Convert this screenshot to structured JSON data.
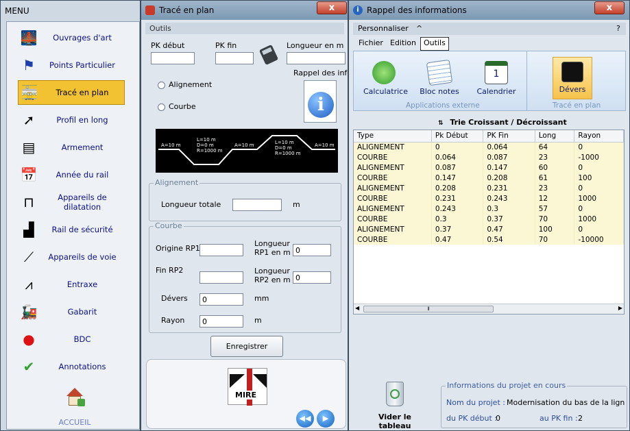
{
  "menu": {
    "title": "MENU",
    "items": [
      {
        "label": "Ouvrages d'art",
        "icon": "bridge-icon"
      },
      {
        "label": "Points Particulier",
        "icon": "flag-icon"
      },
      {
        "label": "Tracé en plan",
        "icon": "train-icon"
      },
      {
        "label": "Profil en long",
        "icon": "arrow-icon"
      },
      {
        "label": "Armement",
        "icon": "sleepers-icon"
      },
      {
        "label": "Année du rail",
        "icon": "calendar-icon"
      },
      {
        "label": "Appareils de dilatation",
        "icon": "dilatation-icon"
      },
      {
        "label": "Rail de sécurité",
        "icon": "rail-icon"
      },
      {
        "label": "Appareils de voie",
        "icon": "switch-icon"
      },
      {
        "label": "Entraxe",
        "icon": "compass-icon"
      },
      {
        "label": "Gabarit",
        "icon": "locomotive-icon"
      },
      {
        "label": "BDC",
        "icon": "signal-icon"
      },
      {
        "label": "Annotations",
        "icon": "checkmark-icon"
      }
    ],
    "home_label": "ACCUEIL"
  },
  "trace": {
    "title": "Tracé en plan",
    "close": "x",
    "outils": "Outils",
    "pk_debut_label": "PK début",
    "pk_fin_label": "PK fin",
    "longueur_label": "Longueur en m",
    "rappel_label": "Rappel des infos",
    "radio_alignement": "Alignement",
    "radio_courbe": "Courbe",
    "diagram": {
      "l1": "L=10 m",
      "d1": "D=0 m",
      "r1": "R=1000 m",
      "l2": "L=10 m",
      "d2": "D=0 m",
      "r2": "R=1000 m",
      "a": "A=10 m"
    },
    "grp_alignement": "Alignement",
    "longueur_totale": "Longueur totale",
    "unit_m": "m",
    "grp_courbe": "Courbe",
    "origine_rp1": "Origine RP1",
    "longueur_rp1_a": "Longueur",
    "longueur_rp1_b": "RP1 en m",
    "rp1_value": "0",
    "fin_rp2": "Fin RP2",
    "longueur_rp2_a": "Longueur",
    "longueur_rp2_b": "RP2 en m",
    "rp2_value": "0",
    "devers": "Dévers",
    "devers_value": "0",
    "unit_mm": "mm",
    "rayon": "Rayon",
    "rayon_value": "0",
    "enregistrer": "Enregistrer",
    "logo_text": "MIRE"
  },
  "rappel": {
    "title": "Rappel des informations",
    "close": "x",
    "personnaliser": "Personnaliser",
    "caret": "^",
    "help": "?",
    "tabs": [
      "Fichier",
      "Edition",
      "Outils"
    ],
    "tools": {
      "calculatrice": "Calculatrice",
      "bloc_notes": "Bloc notes",
      "calendrier": "Calendrier",
      "devers": "Dévers",
      "group1": "Applications externe",
      "group2": "Tracé en plan"
    },
    "sort_label": "Trie Croissant / Décroissant",
    "columns": [
      "Type",
      "Pk Début",
      "PK Fin",
      "Long",
      "Rayon"
    ],
    "rows": [
      [
        "ALIGNEMENT",
        "0",
        "0.064",
        "64",
        "0"
      ],
      [
        "COURBE",
        "0.064",
        "0.087",
        "23",
        "-1000"
      ],
      [
        "ALIGNEMENT",
        "0.087",
        "0.147",
        "60",
        "0"
      ],
      [
        "COURBE",
        "0.147",
        "0.208",
        "61",
        "100"
      ],
      [
        "ALIGNEMENT",
        "0.208",
        "0.231",
        "23",
        "0"
      ],
      [
        "COURBE",
        "0.231",
        "0.243",
        "12",
        "1000"
      ],
      [
        "ALIGNEMENT",
        "0.243",
        "0.3",
        "57",
        "0"
      ],
      [
        "COURBE",
        "0.3",
        "0.37",
        "70",
        "1000"
      ],
      [
        "ALIGNEMENT",
        "0.37",
        "0.47",
        "100",
        "0"
      ],
      [
        "COURBE",
        "0.47",
        "0.54",
        "70",
        "-10000"
      ]
    ],
    "vider": "Vider le tableau",
    "info_group": "Informations du projet en cours",
    "nom_projet_label": "Nom du projet :",
    "nom_projet_value": "Modernisation du bas de la ligne de",
    "pk_debut_label": "du PK début :",
    "pk_debut_value": "0",
    "pk_fin_label": "au PK fin :",
    "pk_fin_value": "2"
  }
}
